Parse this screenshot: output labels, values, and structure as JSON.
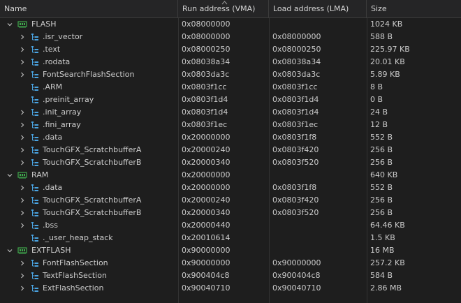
{
  "header": {
    "name": "Name",
    "vma": "Run address (VMA)",
    "lma": "Load address (LMA)",
    "size": "Size"
  },
  "colors": {
    "background": "#1e1e1e",
    "text": "#cccccc",
    "memory_icon": "#3fa84c",
    "section_icon": "#4aa3e0"
  },
  "rows": [
    {
      "level": 0,
      "icon": "memory-region-icon",
      "expanded": true,
      "name": "FLASH",
      "vma": "0x08000000",
      "lma": "",
      "size": "1024 KB"
    },
    {
      "level": 1,
      "icon": "section-icon",
      "expandable": true,
      "name": ".isr_vector",
      "vma": "0x08000000",
      "lma": "0x08000000",
      "size": "588 B"
    },
    {
      "level": 1,
      "icon": "section-icon",
      "expandable": true,
      "name": ".text",
      "vma": "0x08000250",
      "lma": "0x08000250",
      "size": "225.97 KB"
    },
    {
      "level": 1,
      "icon": "section-icon",
      "expandable": true,
      "name": ".rodata",
      "vma": "0x08038a34",
      "lma": "0x08038a34",
      "size": "20.01 KB"
    },
    {
      "level": 1,
      "icon": "section-icon",
      "expandable": true,
      "name": "FontSearchFlashSection",
      "vma": "0x0803da3c",
      "lma": "0x0803da3c",
      "size": "5.89 KB"
    },
    {
      "level": 1,
      "icon": "section-icon",
      "expandable": false,
      "name": ".ARM",
      "vma": "0x0803f1cc",
      "lma": "0x0803f1cc",
      "size": "8 B"
    },
    {
      "level": 1,
      "icon": "section-icon",
      "expandable": false,
      "name": ".preinit_array",
      "vma": "0x0803f1d4",
      "lma": "0x0803f1d4",
      "size": "0 B"
    },
    {
      "level": 1,
      "icon": "section-icon",
      "expandable": true,
      "name": ".init_array",
      "vma": "0x0803f1d4",
      "lma": "0x0803f1d4",
      "size": "24 B"
    },
    {
      "level": 1,
      "icon": "section-icon",
      "expandable": true,
      "name": ".fini_array",
      "vma": "0x0803f1ec",
      "lma": "0x0803f1ec",
      "size": "12 B"
    },
    {
      "level": 1,
      "icon": "section-icon",
      "expandable": true,
      "name": ".data",
      "vma": "0x20000000",
      "lma": "0x0803f1f8",
      "size": "552 B"
    },
    {
      "level": 1,
      "icon": "section-icon",
      "expandable": true,
      "name": "TouchGFX_ScratchbufferA",
      "vma": "0x20000240",
      "lma": "0x0803f420",
      "size": "256 B"
    },
    {
      "level": 1,
      "icon": "section-icon",
      "expandable": true,
      "name": "TouchGFX_ScratchbufferB",
      "vma": "0x20000340",
      "lma": "0x0803f520",
      "size": "256 B"
    },
    {
      "level": 0,
      "icon": "memory-region-icon",
      "expanded": true,
      "name": "RAM",
      "vma": "0x20000000",
      "lma": "",
      "size": "640 KB"
    },
    {
      "level": 1,
      "icon": "section-icon",
      "expandable": true,
      "name": ".data",
      "vma": "0x20000000",
      "lma": "0x0803f1f8",
      "size": "552 B"
    },
    {
      "level": 1,
      "icon": "section-icon",
      "expandable": true,
      "name": "TouchGFX_ScratchbufferA",
      "vma": "0x20000240",
      "lma": "0x0803f420",
      "size": "256 B"
    },
    {
      "level": 1,
      "icon": "section-icon",
      "expandable": true,
      "name": "TouchGFX_ScratchbufferB",
      "vma": "0x20000340",
      "lma": "0x0803f520",
      "size": "256 B"
    },
    {
      "level": 1,
      "icon": "section-icon",
      "expandable": true,
      "name": ".bss",
      "vma": "0x20000440",
      "lma": "",
      "size": "64.46 KB"
    },
    {
      "level": 1,
      "icon": "section-icon",
      "expandable": false,
      "name": "._user_heap_stack",
      "vma": "0x20010614",
      "lma": "",
      "size": "1.5 KB"
    },
    {
      "level": 0,
      "icon": "memory-region-icon",
      "expanded": true,
      "name": "EXTFLASH",
      "vma": "0x90000000",
      "lma": "",
      "size": "16 MB"
    },
    {
      "level": 1,
      "icon": "section-icon",
      "expandable": true,
      "name": "FontFlashSection",
      "vma": "0x90000000",
      "lma": "0x90000000",
      "size": "257.2 KB"
    },
    {
      "level": 1,
      "icon": "section-icon",
      "expandable": true,
      "name": "TextFlashSection",
      "vma": "0x900404c8",
      "lma": "0x900404c8",
      "size": "584 B"
    },
    {
      "level": 1,
      "icon": "section-icon",
      "expandable": true,
      "name": "ExtFlashSection",
      "vma": "0x90040710",
      "lma": "0x90040710",
      "size": "2.86 MB"
    }
  ]
}
